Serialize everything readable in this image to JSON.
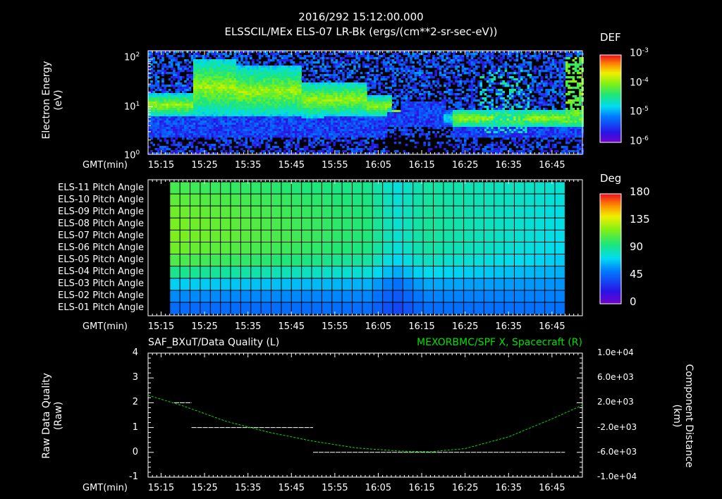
{
  "header": {
    "timestamp": "2016/292 15:12:00.000",
    "subtitle": "ELSSCIL/MEx ELS-07 LR-Bk  (ergs/(cm**2-sr-sec-eV))"
  },
  "colors": {
    "background": "#000000",
    "foreground": "#ffffff",
    "right_axis_series": "#00e000"
  },
  "chart_data": [
    {
      "type": "heatmap",
      "name": "electron-spectrogram",
      "ylabel": "Electron Energy (eV)",
      "ylabel_lines": [
        "Electron Energy",
        "(eV)"
      ],
      "yscale": "log",
      "ylim": [
        1,
        150
      ],
      "ytick_labels": [
        "10^0",
        "10^1",
        "10^2"
      ],
      "xlabel": "GMT(min)",
      "xtick_labels": [
        "15:15",
        "15:25",
        "15:35",
        "15:45",
        "15:55",
        "16:05",
        "16:15",
        "16:25",
        "16:35",
        "16:45"
      ],
      "xlim": [
        "15:12",
        "16:52"
      ],
      "colorbar": {
        "label": "DEF",
        "scale": "log",
        "tick_labels": [
          "10^-3",
          "10^-4",
          "10^-5",
          "10^-6"
        ],
        "range": [
          1e-06,
          0.001
        ]
      }
    },
    {
      "type": "heatmap",
      "name": "pitch-angle-grid",
      "row_labels": [
        "ELS-11 Pitch Angle",
        "ELS-10 Pitch Angle",
        "ELS-09 Pitch Angle",
        "ELS-08 Pitch Angle",
        "ELS-07 Pitch Angle",
        "ELS-06 Pitch Angle",
        "ELS-05 Pitch Angle",
        "ELS-04 Pitch Angle",
        "ELS-03 Pitch Angle",
        "ELS-02 Pitch Angle",
        "ELS-01 Pitch Angle"
      ],
      "xlabel": "GMT(min)",
      "xtick_labels": [
        "15:15",
        "15:25",
        "15:35",
        "15:45",
        "15:55",
        "16:05",
        "16:15",
        "16:25",
        "16:35",
        "16:45"
      ],
      "xlim": [
        "15:12",
        "16:52"
      ],
      "data_xlim": [
        "15:17",
        "16:48"
      ],
      "columns": 39,
      "row_angles_start": [
        108,
        114,
        118,
        120,
        121,
        118,
        110,
        95,
        73,
        58,
        50
      ],
      "row_angles_end": [
        82,
        80,
        78,
        78,
        77,
        76,
        72,
        66,
        60,
        56,
        52
      ],
      "dip_time": "16:08",
      "colorbar": {
        "label": "Deg",
        "tick_labels": [
          "180",
          "135",
          "90",
          "45",
          "0"
        ],
        "range": [
          0,
          180
        ]
      }
    },
    {
      "type": "line",
      "name": "data-quality-and-position",
      "title_left": "SAF_BXuT/Data Quality (L)",
      "title_right": "MEXORBMC/SPF X, Spacecraft (R)",
      "xlabel": "GMT(min)",
      "xtick_labels": [
        "15:15",
        "15:25",
        "15:35",
        "15:45",
        "15:55",
        "16:05",
        "16:15",
        "16:25",
        "16:35",
        "16:45"
      ],
      "xlim": [
        "15:12",
        "16:52"
      ],
      "left_axis": {
        "label": "Raw Data Quality (Raw)",
        "label_lines": [
          "Raw Data Quality",
          "(Raw)"
        ],
        "ylim": [
          -1,
          4
        ],
        "tick_labels": [
          "4",
          "3",
          "2",
          "1",
          "0",
          "-1"
        ]
      },
      "right_axis": {
        "label": "Component Distance (km)",
        "label_lines": [
          "Component Distance",
          "(km)"
        ],
        "ylim": [
          -10000,
          10000
        ],
        "tick_labels": [
          "1.0e+04",
          "6.0e+03",
          "2.0e+03",
          "-2.0e+03",
          "-6.0e+03",
          "-1.0e+04"
        ]
      },
      "series": [
        {
          "axis": "left",
          "color": "#ffffff",
          "segments": [
            {
              "x": [
                "15:18",
                "15:22"
              ],
              "y": 2
            },
            {
              "x": [
                "15:22",
                "15:50"
              ],
              "y": 1
            },
            {
              "x": [
                "15:50",
                "16:48"
              ],
              "y": 0
            }
          ]
        },
        {
          "axis": "right",
          "color": "#00e000",
          "x": [
            "15:12",
            "15:20",
            "15:30",
            "15:40",
            "15:50",
            "16:00",
            "16:10",
            "16:17",
            "16:25",
            "16:35",
            "16:45",
            "16:52"
          ],
          "y": [
            3200,
            1500,
            -1000,
            -2800,
            -4200,
            -5300,
            -5800,
            -5900,
            -5400,
            -3500,
            -600,
            1600
          ]
        }
      ]
    }
  ]
}
